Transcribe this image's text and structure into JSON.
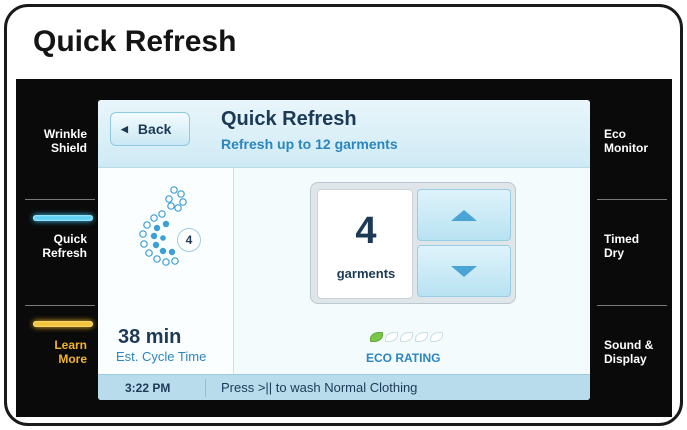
{
  "page": {
    "title": "Quick Refresh"
  },
  "left_nav": [
    {
      "label_line1": "Wrinkle",
      "label_line2": "Shield",
      "indicator": "none"
    },
    {
      "label_line1": "Quick",
      "label_line2": "Refresh",
      "indicator": "blue"
    },
    {
      "label_line1": "Learn",
      "label_line2": "More",
      "indicator": "gold"
    }
  ],
  "right_nav": [
    {
      "label_line1": "Eco",
      "label_line2": "Monitor"
    },
    {
      "label_line1": "Timed",
      "label_line2": "Dry"
    },
    {
      "label_line1": "Sound &",
      "label_line2": "Display"
    }
  ],
  "screen": {
    "back_label": "Back",
    "title": "Quick Refresh",
    "subtitle": "Refresh up to 12 garments",
    "cycle_badge": "4",
    "cycle_time": "38 min",
    "cycle_time_label": "Est. Cycle Time",
    "garment_count": "4",
    "garment_label": "garments",
    "eco_rating_label": "ECO RATING",
    "eco_rating": {
      "filled": 1,
      "total": 5
    },
    "clock": "3:22 PM",
    "status_message": "Press >|| to wash Normal Clothing"
  },
  "colors": {
    "accent_blue": "#2b86c0",
    "navy_text": "#1c3a56",
    "learn_more_gold": "#f2b42a",
    "indicator_blue": "#5fd3f5",
    "leaf_green": "#7cc74a"
  },
  "icons": {
    "back": "left-triangle-icon",
    "increase": "up-arrow-icon",
    "decrease": "down-arrow-icon",
    "cycle": "spiral-dots-icon",
    "eco": "leaf-icon"
  }
}
